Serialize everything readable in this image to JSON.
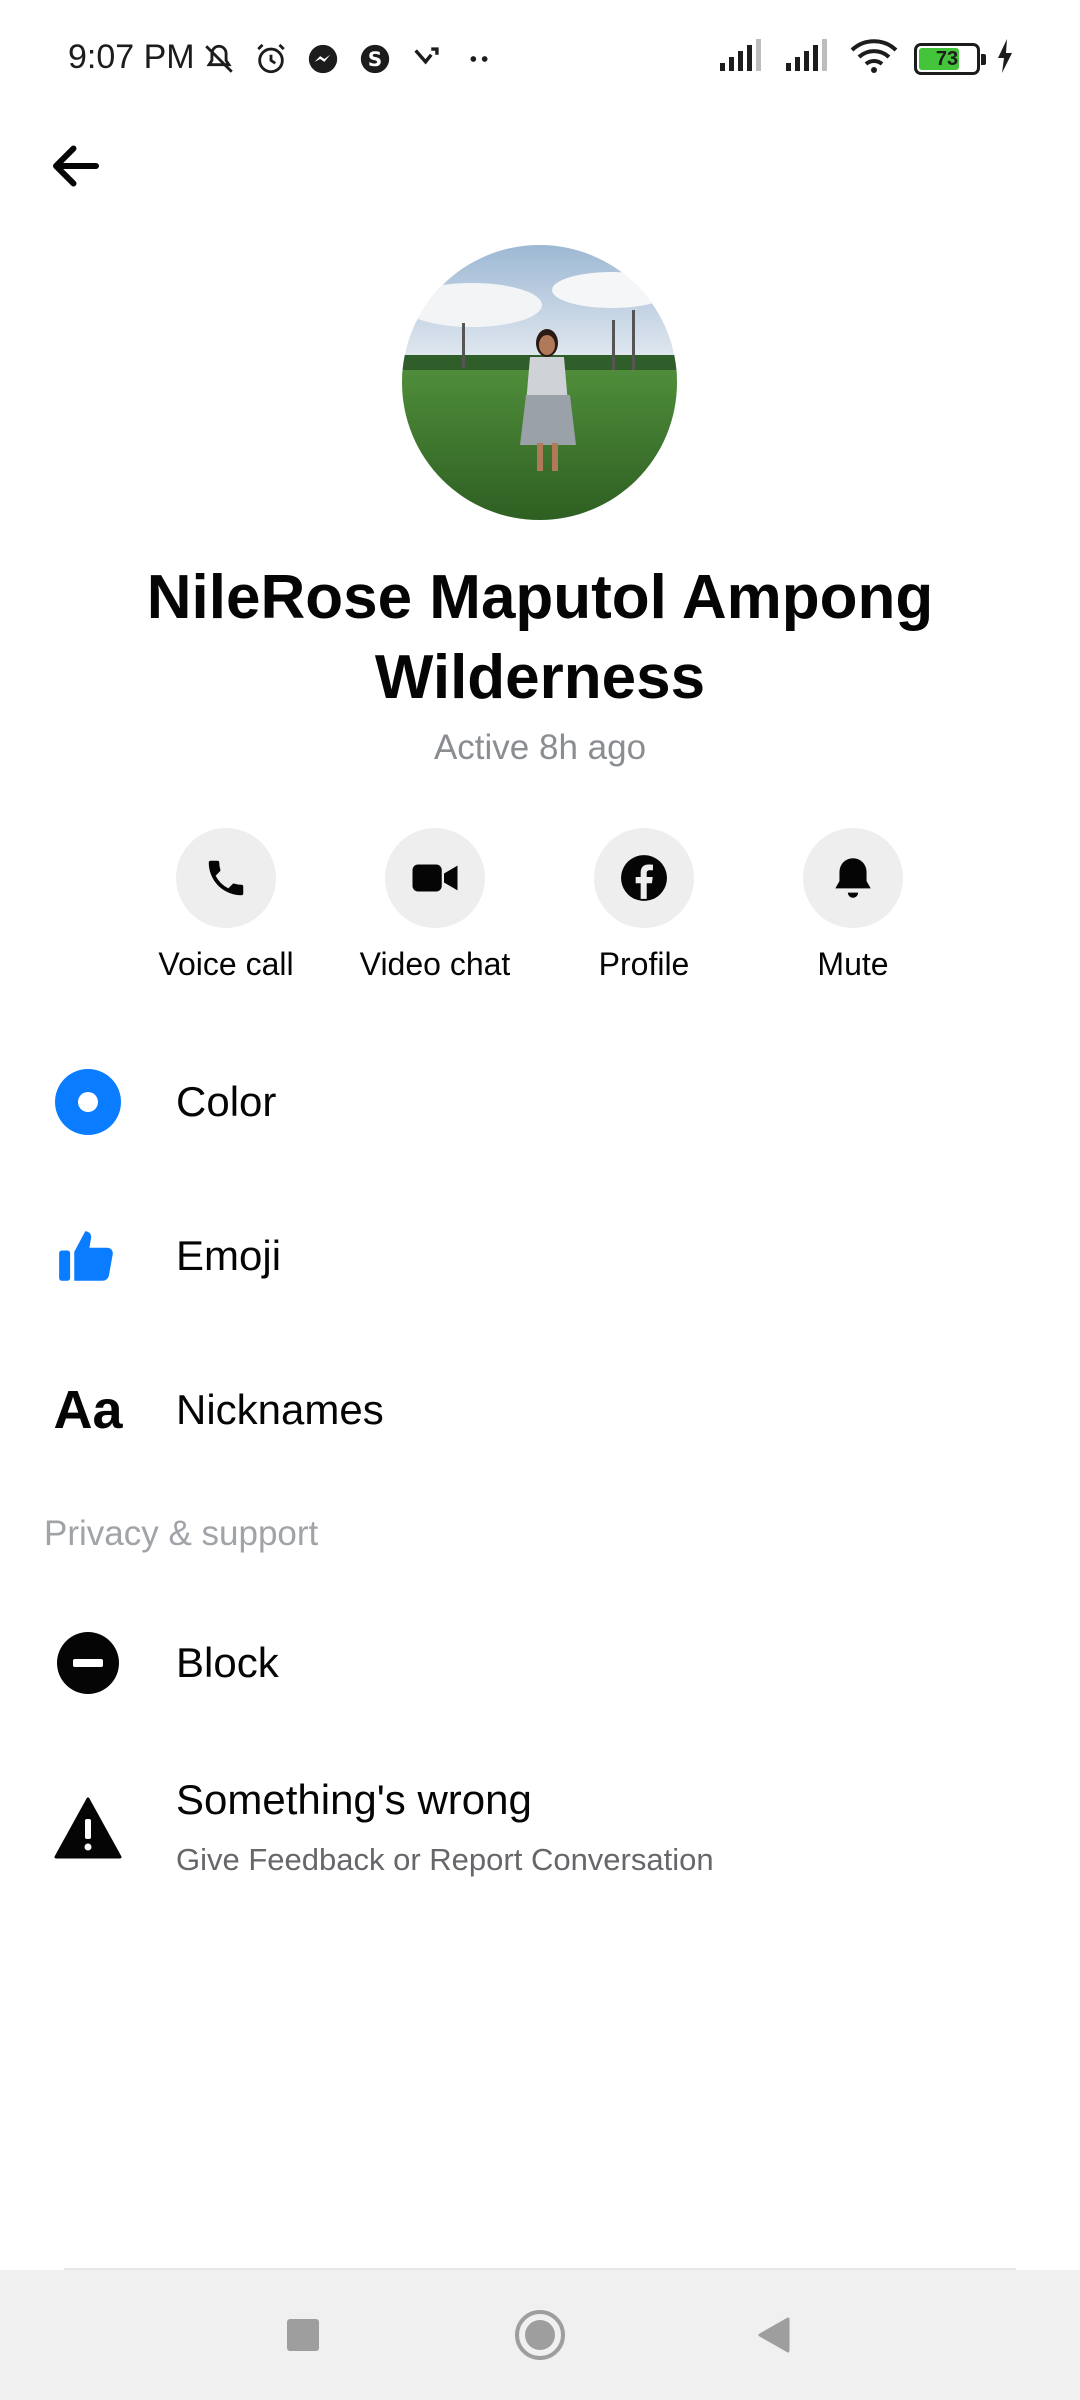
{
  "status_bar": {
    "time": "9:07 PM",
    "battery_level": 73,
    "battery_text": "73",
    "icons": [
      "mute-icon",
      "alarm-icon",
      "messenger-icon",
      "dollar-icon",
      "call-forward-icon",
      "more-dots-icon",
      "signal-icon",
      "signal-icon",
      "wifi-icon",
      "battery-icon",
      "charging-icon"
    ]
  },
  "header": {
    "back_icon": "back-arrow-icon"
  },
  "profile": {
    "name": "NileRose Maputol Ampong Wilderness",
    "status": "Active 8h ago"
  },
  "actions": [
    {
      "label": "Voice call",
      "icon": "phone-icon"
    },
    {
      "label": "Video chat",
      "icon": "video-camera-icon"
    },
    {
      "label": "Profile",
      "icon": "facebook-icon"
    },
    {
      "label": "Mute",
      "icon": "bell-icon"
    }
  ],
  "customization": [
    {
      "label": "Color",
      "icon": "color-circle-icon"
    },
    {
      "label": "Emoji",
      "icon": "thumbs-up-icon"
    },
    {
      "label": "Nicknames",
      "icon": "nicknames-aa-icon",
      "icon_text": "Aa"
    }
  ],
  "privacy": {
    "header": "Privacy & support",
    "items": [
      {
        "label": "Block",
        "icon": "block-icon"
      },
      {
        "label": "Something's wrong",
        "sublabel": "Give Feedback or Report Conversation",
        "icon": "warning-icon"
      }
    ]
  },
  "colors": {
    "accent": "#0a7cff",
    "action_bg": "#eeeeee",
    "secondary_text": "#65676b",
    "battery_green": "#44c43a"
  },
  "nav": [
    "recents-square-icon",
    "home-circle-icon",
    "back-triangle-icon"
  ]
}
